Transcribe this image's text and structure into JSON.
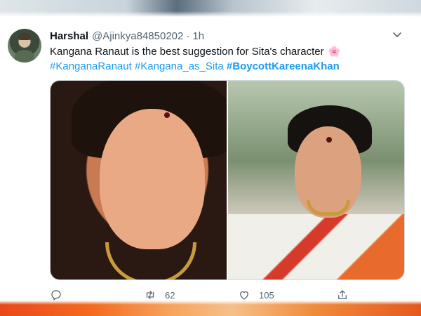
{
  "tweet": {
    "author_name": "Harshal",
    "handle": "@Ajinkya84850202",
    "separator": "·",
    "time": "1h",
    "text": "Kangana Ranaut is the best suggestion for Sita's character",
    "emoji": "🌸",
    "hashtags": [
      "#KanganaRanaut",
      "#Kangana_as_Sita",
      "#BoycottKareenaKhan"
    ],
    "media": [
      {
        "icon": "photo-kangana-closeup"
      },
      {
        "icon": "photo-kangana-saree"
      }
    ],
    "actions": {
      "reply": {
        "icon": "reply-icon"
      },
      "retweet": {
        "icon": "retweet-icon",
        "count": "62"
      },
      "like": {
        "icon": "heart-icon",
        "count": "105"
      },
      "share": {
        "icon": "share-icon"
      }
    }
  },
  "colors": {
    "link": "#1d9bf0",
    "secondary_text": "#536471",
    "primary_text": "#0f1419"
  }
}
